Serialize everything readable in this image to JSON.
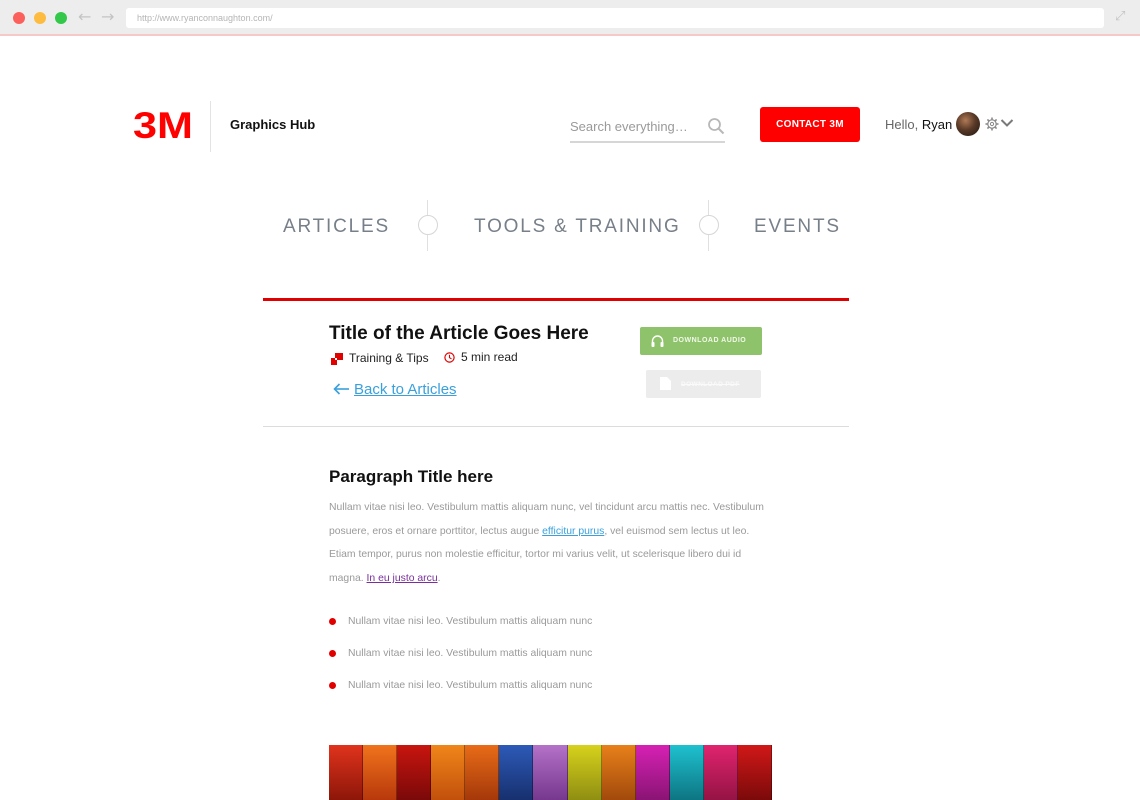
{
  "browser": {
    "url": "http://www.ryanconnaughton.com/"
  },
  "header": {
    "site_name": "Graphics Hub",
    "search_placeholder": "Search everything…",
    "contact_label": "CONTACT 3M",
    "greeting_prefix": "Hello, ",
    "user_name": "Ryan"
  },
  "nav": {
    "items": [
      "ARTICLES",
      "TOOLS & TRAINING",
      "EVENTS"
    ]
  },
  "article": {
    "title": "Title of the Article Goes Here",
    "category": "Training & Tips",
    "read_time": "5 min read",
    "back_link": "Back to Articles",
    "download_audio": "DOWNLOAD AUDIO",
    "download_pdf": "DOWNLOAD PDF",
    "paragraph_title": "Paragraph Title here",
    "paragraph": {
      "part1": "Nullam vitae nisi leo. Vestibulum mattis aliquam nunc, vel tincidunt arcu mattis nec. Vestibulum posuere, eros et ornare porttitor, lectus augue ",
      "link1": "efficitur purus",
      "part2": ", vel euismod sem lectus ut leo. Etiam tempor, purus non molestie efficitur, tortor mi varius velit, ut scelerisque libero dui id magna. ",
      "link2": "In eu justo arcu",
      "part3": "."
    },
    "bullets": [
      "Nullam vitae nisi leo. Vestibulum mattis aliquam nunc",
      "Nullam vitae nisi leo. Vestibulum mattis aliquam nunc",
      "Nullam vitae nisi leo. Vestibulum mattis aliquam nunc"
    ]
  },
  "colors": {
    "brand_red": "#ff0000",
    "audio_green": "#8fc36b",
    "link_blue": "#3aa0dc",
    "visited_purple": "#7a2e9c"
  },
  "icons": [
    "search-icon",
    "gear-icon",
    "chevron-down-icon",
    "headphones-icon",
    "file-icon",
    "clock-icon",
    "arrow-left-icon"
  ]
}
